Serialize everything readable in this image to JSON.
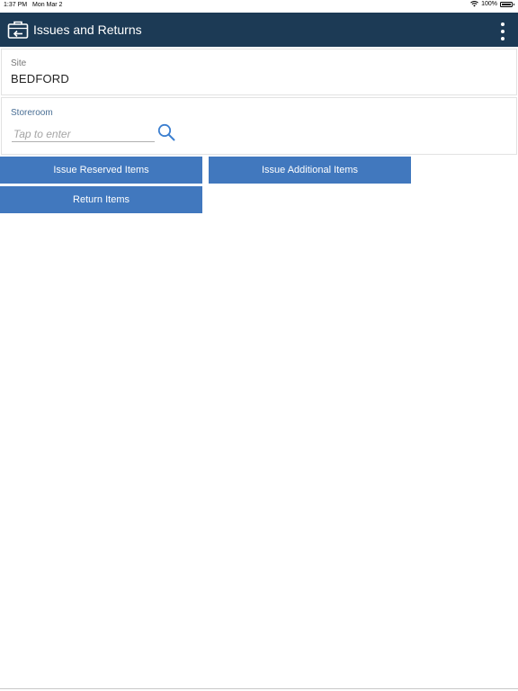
{
  "status_bar": {
    "time": "1:37 PM",
    "date": "Mon Mar 2",
    "battery": "100%"
  },
  "header": {
    "title": "Issues and Returns",
    "icon": "briefcase-return-icon",
    "menu_icon": "more-vertical-icon",
    "background": "#1c3a55"
  },
  "site": {
    "label": "Site",
    "value": "BEDFORD"
  },
  "storeroom": {
    "label": "Storeroom",
    "placeholder": "Tap to enter",
    "value": "",
    "search_icon": "search-icon"
  },
  "actions": {
    "issue_reserved": "Issue Reserved Items",
    "issue_additional": "Issue Additional Items",
    "return_items": "Return Items",
    "button_color": "#4178be"
  }
}
